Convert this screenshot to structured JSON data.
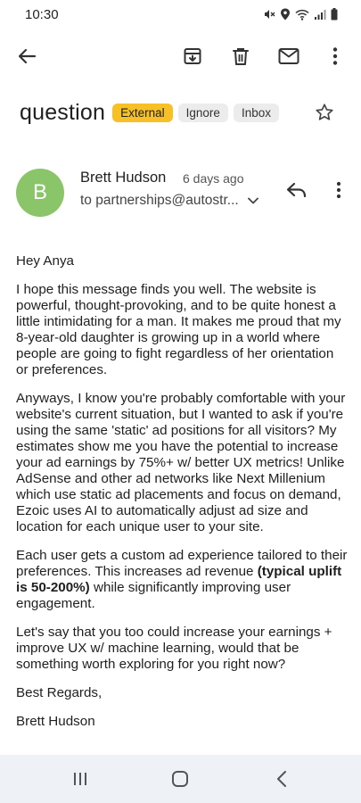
{
  "status_bar": {
    "time": "10:30",
    "icons": [
      "mute-icon",
      "location-icon",
      "wifi-icon",
      "signal-icon",
      "battery-icon"
    ]
  },
  "toolbar": {
    "icons": [
      "back-arrow-icon",
      "archive-icon",
      "delete-icon",
      "mail-icon",
      "more-vert-icon"
    ]
  },
  "email": {
    "subject": "question",
    "labels": {
      "external": "External",
      "ignore": "Ignore",
      "inbox": "Inbox"
    },
    "sender": {
      "initial": "B",
      "name": "Brett Hudson",
      "time": "6 days ago",
      "recipient": "to partnerships@autostr..."
    },
    "body": {
      "greeting": "Hey Anya",
      "p1": "I hope this message finds you well. The website is powerful, thought-provoking, and to be quite honest a little intimidating for a man. It makes me proud that my 8-year-old daughter is growing up in a world where people are going to fight regardless of her orientation or preferences.",
      "p2": "Anyways, I know you're probably comfortable with your website's current situation, but I wanted to ask if you're using the same 'static' ad positions for all visitors? My estimates show me you have the potential to increase your ad earnings by 75%+ w/ better UX metrics! Unlike AdSense and other ad networks like Next Millenium which use static ad placements and focus on demand, Ezoic uses AI to automatically adjust ad size and location for each unique user to your site.",
      "p3_start": "Each user gets a custom ad experience tailored to their preferences. This increases ad revenue ",
      "p3_bold": "(typical uplift is 50-200%)",
      "p3_end": " while significantly improving user engagement.",
      "p4": "Let's say that you too could increase your earnings + improve UX w/ machine learning, would that be something worth exploring for you right now?",
      "closing": "Best Regards,",
      "signature": "Brett Hudson"
    }
  },
  "colors": {
    "external_label": "#f6c026",
    "avatar": "#8bc56a",
    "nav_bar": "#eef2f7"
  },
  "nav_bar": {
    "icons": [
      "recents-icon",
      "home-icon",
      "back-nav-icon"
    ]
  }
}
